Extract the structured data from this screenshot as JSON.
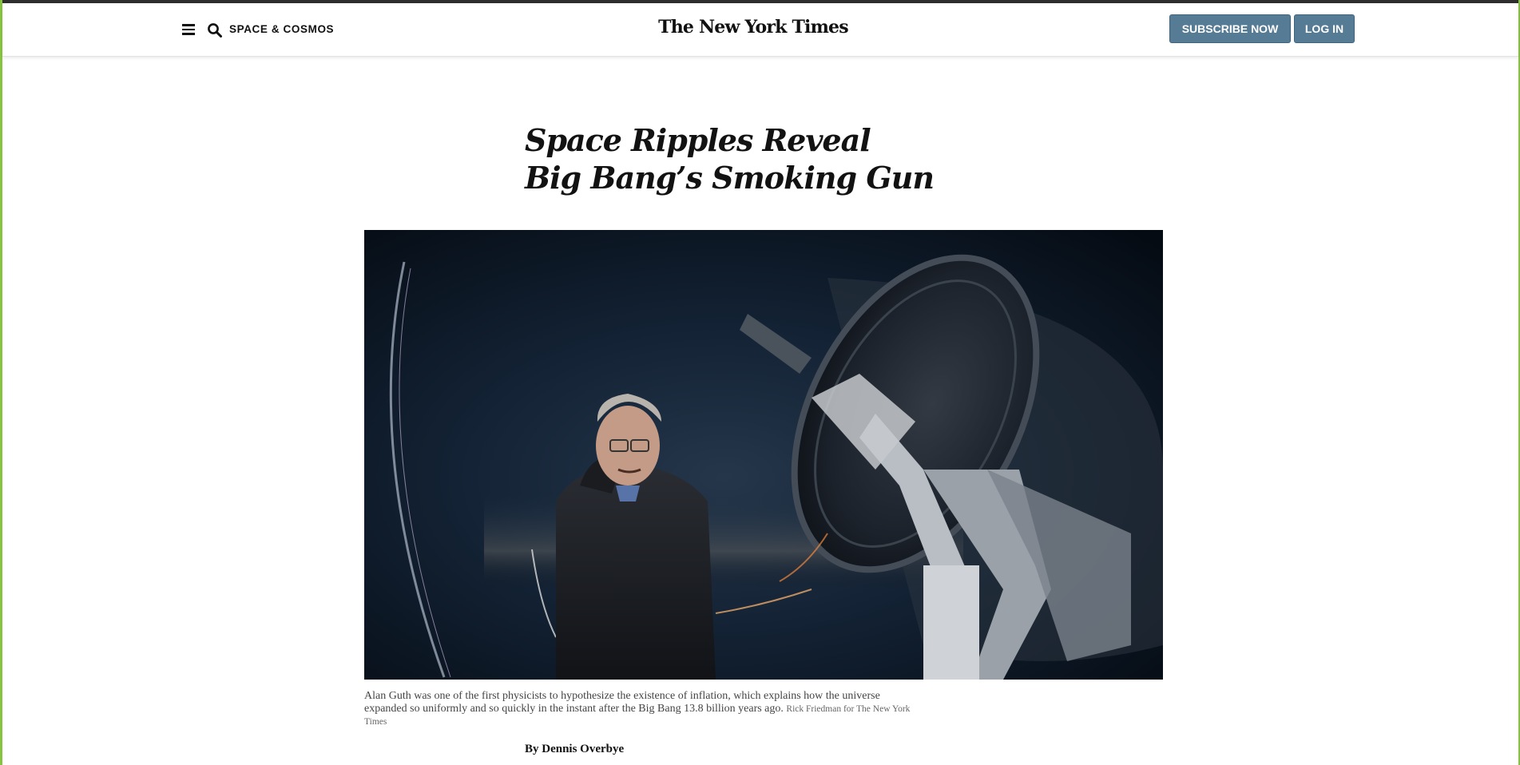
{
  "header": {
    "section": "SPACE & COSMOS",
    "logo": "The New York Times",
    "subscribe_label": "SUBSCRIBE NOW",
    "login_label": "LOG IN",
    "menu_icon": "hamburger-menu-icon",
    "search_icon": "search-icon"
  },
  "article": {
    "headline_line1": "Space Ripples Reveal",
    "headline_line2": "Big Bang’s Smoking Gun",
    "caption": "Alan Guth was one of the first physicists to hypothesize the existence of inflation, which explains how the universe expanded so uniformly and so quickly in the instant after the Big Bang 13.8 billion years ago.",
    "credit": "Rick Friedman for The New York Times",
    "byline": "By Dennis Overbye"
  },
  "colors": {
    "button_bg": "#567b95",
    "frame_accent": "#86c440",
    "top_bar": "#2e2e2e"
  }
}
